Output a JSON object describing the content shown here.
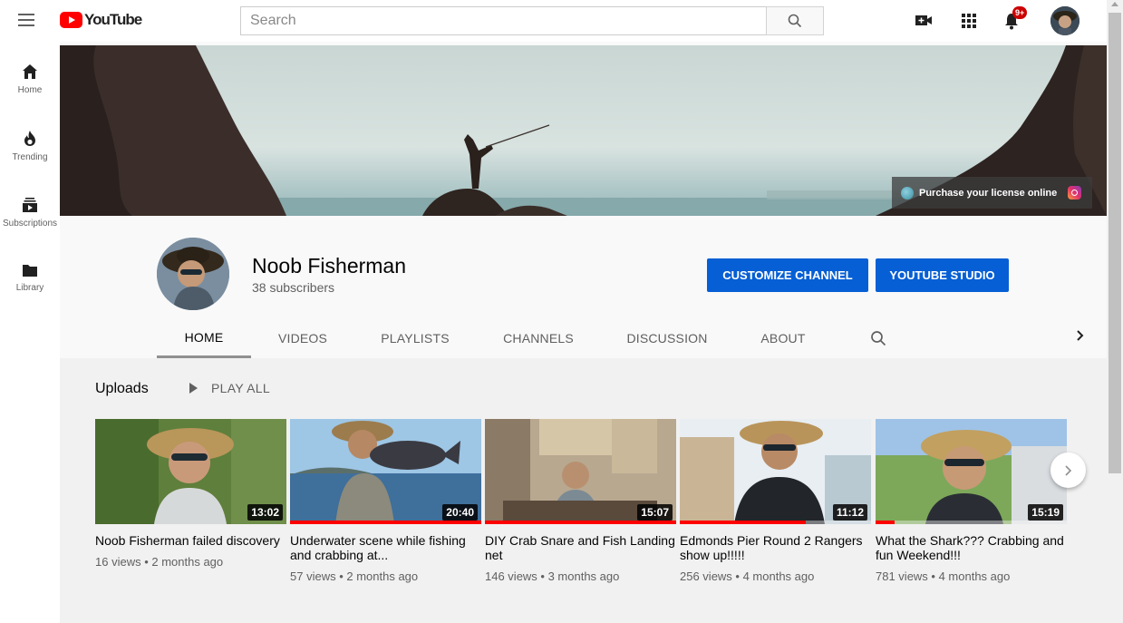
{
  "masthead": {
    "logo_text": "YouTube",
    "search_placeholder": "Search",
    "notification_count": "9+"
  },
  "guide": {
    "items": [
      {
        "label": "Home",
        "icon": "home-icon"
      },
      {
        "label": "Trending",
        "icon": "trending-flame-icon"
      },
      {
        "label": "Subscriptions",
        "icon": "subscriptions-icon"
      },
      {
        "label": "Library",
        "icon": "folder-library-icon"
      }
    ]
  },
  "banner": {
    "link_text": "Purchase your license online"
  },
  "channel": {
    "name": "Noob Fisherman",
    "subscribers": "38 subscribers",
    "customize_label": "CUSTOMIZE CHANNEL",
    "studio_label": "YOUTUBE STUDIO"
  },
  "tabs": [
    {
      "label": "HOME",
      "active": true
    },
    {
      "label": "VIDEOS"
    },
    {
      "label": "PLAYLISTS"
    },
    {
      "label": "CHANNELS"
    },
    {
      "label": "DISCUSSION"
    },
    {
      "label": "ABOUT"
    }
  ],
  "shelf": {
    "title": "Uploads",
    "play_all": "PLAY ALL",
    "videos": [
      {
        "title": "Noob Fisherman failed discovery",
        "duration": "13:02",
        "meta": "16 views • 2 months ago",
        "progress": 0
      },
      {
        "title": "Underwater scene while fishing and crabbing at...",
        "duration": "20:40",
        "meta": "57 views • 2 months ago",
        "progress": 1.0
      },
      {
        "title": "DIY Crab Snare and Fish Landing net",
        "duration": "15:07",
        "meta": "146 views • 3 months ago",
        "progress": 1.0
      },
      {
        "title": "Edmonds Pier Round 2 Rangers show up!!!!!",
        "duration": "11:12",
        "meta": "256 views • 4 months ago",
        "progress": 0.66
      },
      {
        "title": "What the Shark??? Crabbing and fun Weekend!!!",
        "duration": "15:19",
        "meta": "781 views • 4 months ago",
        "progress": 0.1
      }
    ]
  },
  "colors": {
    "accent_blue": "#065fd4",
    "youtube_red": "#ff0000"
  }
}
